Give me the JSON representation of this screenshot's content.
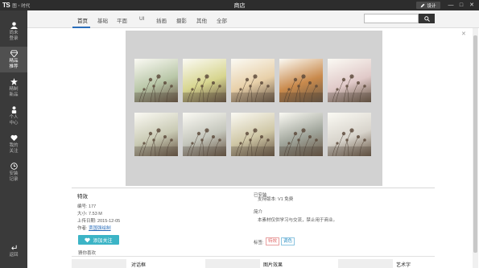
{
  "titlebar": {
    "logo_mark": "TS",
    "logo_text": "图・时代",
    "window_title": "商店",
    "design_label": "设计",
    "controls": [
      "—",
      "□",
      "✕"
    ]
  },
  "sidebar": {
    "items": [
      {
        "label1": "尚未",
        "label2": "登录",
        "icon": "user-icon"
      },
      {
        "label1": "精品",
        "label2": "推荐",
        "icon": "diamond-icon"
      },
      {
        "label1": "精制",
        "label2": "新品",
        "icon": "star-icon"
      },
      {
        "label1": "个人",
        "label2": "中心",
        "icon": "person-icon"
      },
      {
        "label1": "我的",
        "label2": "关注",
        "icon": "heart-icon"
      },
      {
        "label1": "安装",
        "label2": "记录",
        "icon": "clock-icon"
      }
    ],
    "back_label": "返回"
  },
  "nav": {
    "tabs": [
      "首页",
      "基础",
      "平面",
      "UI",
      "插画",
      "摄影",
      "其他",
      "全部"
    ],
    "active_tab": "首页"
  },
  "search": {
    "placeholder": ""
  },
  "preview": {
    "tints": [
      "#b9c7a8",
      "#d7d58f",
      "#e8d0a9",
      "#c98a4c",
      "#e0c9c8",
      "#c9cab4",
      "#c4c6bc",
      "#cfc7a6",
      "#9fa49a",
      "#d8d4cc"
    ]
  },
  "info": {
    "title": "特效",
    "id": "编号: 177",
    "size": "大小: 7.53 M",
    "upload_date": "上传日期: 2015-12-05",
    "author_label": "作者:",
    "author_link": "贾国强绘制",
    "follow_button": "添加关注",
    "recommend_label": "猜你喜欢"
  },
  "details": {
    "installed_label": "已安装",
    "version_text": "支持版本: V1  免费",
    "intro_label": "简介",
    "intro_text": "本素材仅供学习与交流，禁止用于商业。",
    "tags_label": "标签:",
    "tags": [
      "特效",
      "调色"
    ]
  },
  "recommendations": [
    "对话框",
    "图片效果",
    "艺术字"
  ],
  "colors": {
    "accent": "#2a6ebb",
    "follow_button": "#3cb4c6",
    "sidebar_bg": "#3a3a3a",
    "titlebar_bg": "#2d2d2d"
  }
}
